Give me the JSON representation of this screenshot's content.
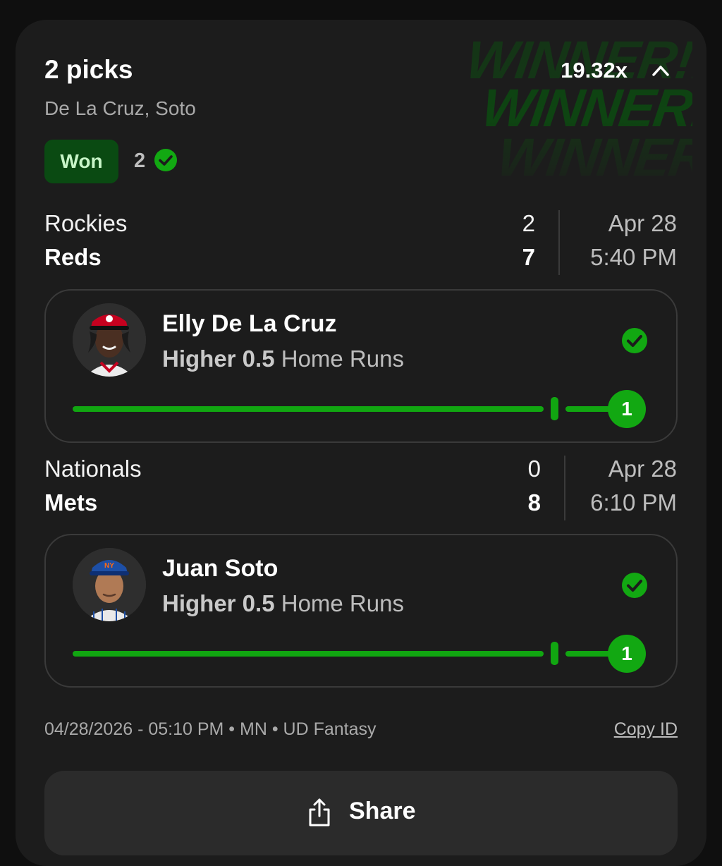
{
  "header": {
    "title": "2 picks",
    "multiplier": "19.32x",
    "subtitle": "De La Cruz, Soto",
    "status_badge": "Won",
    "won_count": "2",
    "background_text": "WINNER!!"
  },
  "games": [
    {
      "team1": "Rockies",
      "score1": "2",
      "team2": "Reds",
      "score2": "7",
      "date": "Apr 28",
      "time": "5:40 PM",
      "pick": {
        "player": "Elly De La Cruz",
        "direction_line": "Higher 0.5",
        "stat": "Home Runs",
        "result": "1",
        "line_value": 0.5
      }
    },
    {
      "team1": "Nationals",
      "score1": "0",
      "team2": "Mets",
      "score2": "8",
      "date": "Apr 28",
      "time": "6:10 PM",
      "pick": {
        "player": "Juan Soto",
        "direction_line": "Higher 0.5",
        "stat": "Home Runs",
        "result": "1",
        "line_value": 0.5
      }
    }
  ],
  "footer": {
    "meta": "04/28/2026 - 05:10 PM • MN • UD Fantasy",
    "copy_id": "Copy ID"
  },
  "share": {
    "label": "Share"
  },
  "colors": {
    "accent_green": "#12a812",
    "badge_bg": "#0a4a12",
    "card_bg": "#1c1c1c",
    "page_bg": "#0f0f0f"
  },
  "icons": {
    "expand": "chevron-up-icon",
    "won": "check-circle-icon",
    "share": "share-icon"
  }
}
